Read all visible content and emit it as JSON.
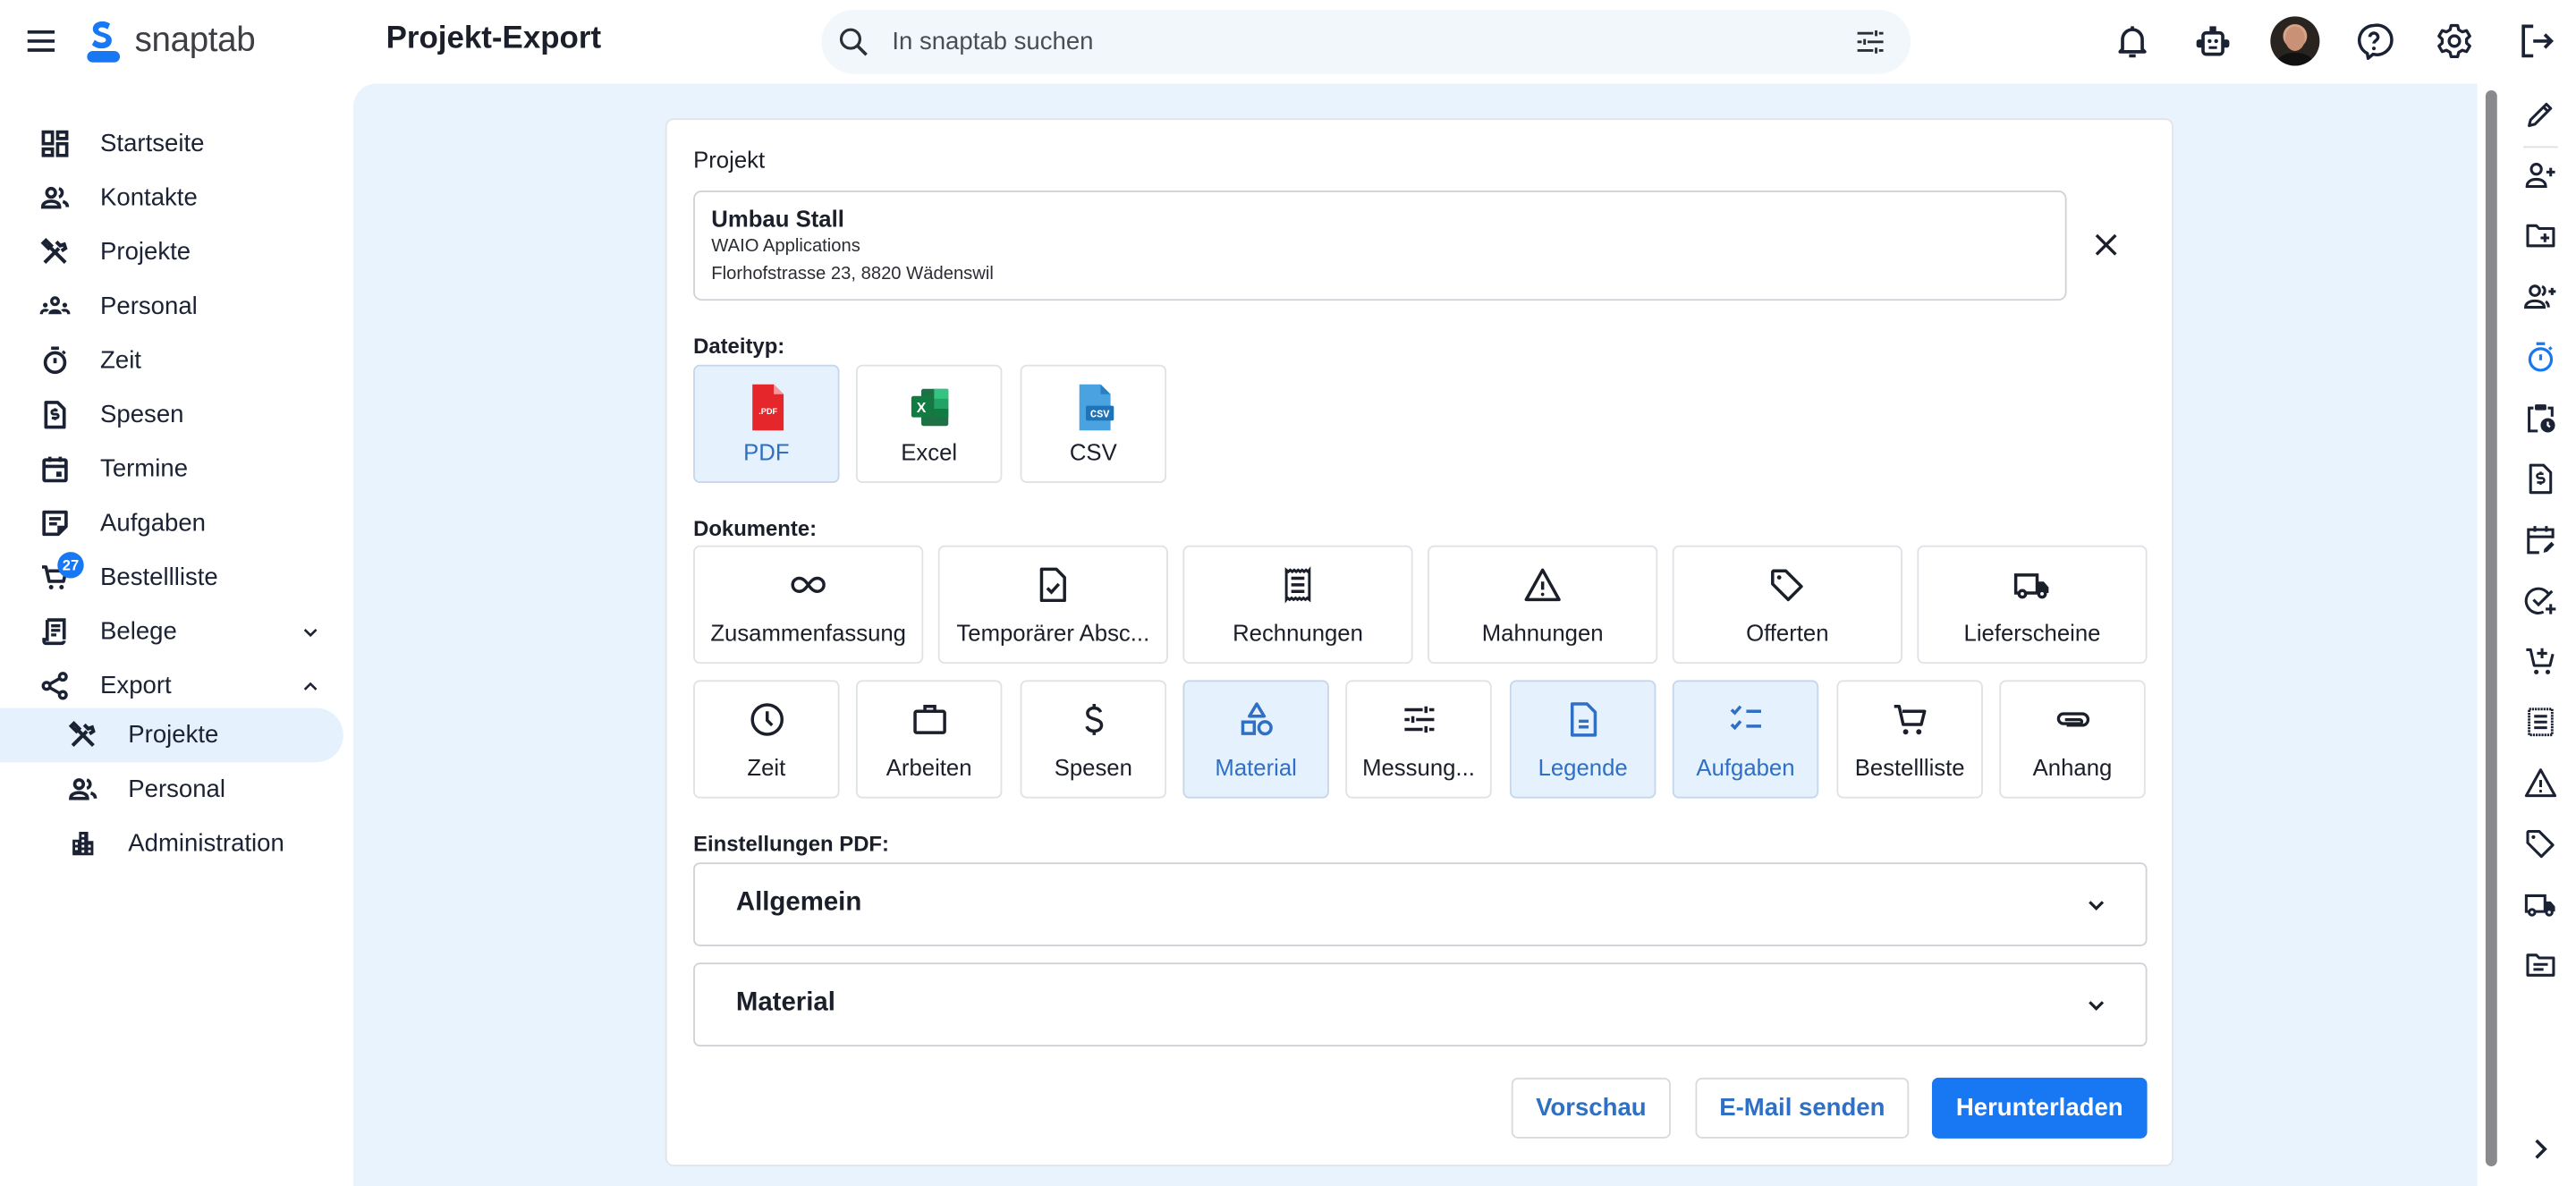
{
  "header": {
    "app_name": "snaptab",
    "page_title": "Projekt-Export",
    "search": {
      "placeholder": "In snaptab suchen",
      "value": ""
    },
    "icons": [
      "menu-icon",
      "search-icon",
      "tune-icon",
      "bell-icon",
      "robot-icon",
      "avatar",
      "help-icon",
      "settings-icon",
      "logout-icon"
    ]
  },
  "sidebar": {
    "items": [
      {
        "label": "Startseite",
        "icon": "dashboard-icon"
      },
      {
        "label": "Kontakte",
        "icon": "contacts-icon"
      },
      {
        "label": "Projekte",
        "icon": "tools-icon"
      },
      {
        "label": "Personal",
        "icon": "groups-icon"
      },
      {
        "label": "Zeit",
        "icon": "timer-icon"
      },
      {
        "label": "Spesen",
        "icon": "receipt-dollar-icon"
      },
      {
        "label": "Termine",
        "icon": "calendar-icon"
      },
      {
        "label": "Aufgaben",
        "icon": "note-icon"
      },
      {
        "label": "Bestellliste",
        "icon": "cart-icon",
        "badge": "27"
      },
      {
        "label": "Belege",
        "icon": "receipt-icon",
        "expanded": false
      },
      {
        "label": "Export",
        "icon": "share-icon",
        "expanded": true
      }
    ],
    "export_children": [
      {
        "label": "Projekte",
        "icon": "tools-icon",
        "active": true
      },
      {
        "label": "Personal",
        "icon": "contacts-icon",
        "active": false
      },
      {
        "label": "Administration",
        "icon": "building-icon",
        "active": false
      }
    ]
  },
  "form": {
    "project_label": "Projekt",
    "project": {
      "name": "Umbau Stall",
      "company": "WAIO Applications",
      "address": "Florhofstrasse 23, 8820 Wädenswil"
    },
    "filetype_label": "Dateityp:",
    "filetypes": [
      {
        "label": "PDF",
        "selected": true
      },
      {
        "label": "Excel",
        "selected": false
      },
      {
        "label": "CSV",
        "selected": false
      }
    ],
    "documents_label": "Dokumente:",
    "documents_row1": [
      {
        "label": "Zusammenfassung",
        "icon": "infinity-icon",
        "selected": false
      },
      {
        "label": "Temporärer Absc...",
        "icon": "file-check-icon",
        "selected": false
      },
      {
        "label": "Rechnungen",
        "icon": "receipt-icon",
        "selected": false
      },
      {
        "label": "Mahnungen",
        "icon": "warning-icon",
        "selected": false
      },
      {
        "label": "Offerten",
        "icon": "tag-icon",
        "selected": false
      },
      {
        "label": "Lieferscheine",
        "icon": "truck-icon",
        "selected": false
      }
    ],
    "documents_row2": [
      {
        "label": "Zeit",
        "icon": "clock-icon",
        "selected": false
      },
      {
        "label": "Arbeiten",
        "icon": "briefcase-icon",
        "selected": false
      },
      {
        "label": "Spesen",
        "icon": "dollar-icon",
        "selected": false
      },
      {
        "label": "Material",
        "icon": "shapes-icon",
        "selected": true
      },
      {
        "label": "Messung...",
        "icon": "tune-icon",
        "selected": false
      },
      {
        "label": "Legende",
        "icon": "document-icon",
        "selected": true
      },
      {
        "label": "Aufgaben",
        "icon": "checklist-icon",
        "selected": true
      },
      {
        "label": "Bestellliste",
        "icon": "cart-icon",
        "selected": false
      },
      {
        "label": "Anhang",
        "icon": "paperclip-icon",
        "selected": false
      }
    ],
    "settings_label": "Einstellungen PDF:",
    "accordions": [
      {
        "title": "Allgemein",
        "expanded": false
      },
      {
        "title": "Material",
        "expanded": false
      }
    ],
    "buttons": {
      "preview": "Vorschau",
      "email": "E-Mail senden",
      "download": "Herunterladen"
    }
  },
  "rail": {
    "icons": [
      "pencil-icon",
      "person-add-icon",
      "folder-add-icon",
      "group-add-icon",
      "timer-icon",
      "clipboard-clock-icon",
      "receipt-dollar-icon",
      "calendar-edit-icon",
      "check-add-icon",
      "cart-add-icon",
      "receipt-icon",
      "warning-icon",
      "tag-icon",
      "truck-icon",
      "folder-list-icon",
      "chevron-right-icon"
    ],
    "active": "timer-icon"
  },
  "colors": {
    "accent": "#1877f2",
    "selected_bg": "#e5f1fc",
    "content_bg": "#e8f3fd",
    "text_dark": "#1b2233",
    "selected_text": "#2f6fc4"
  }
}
